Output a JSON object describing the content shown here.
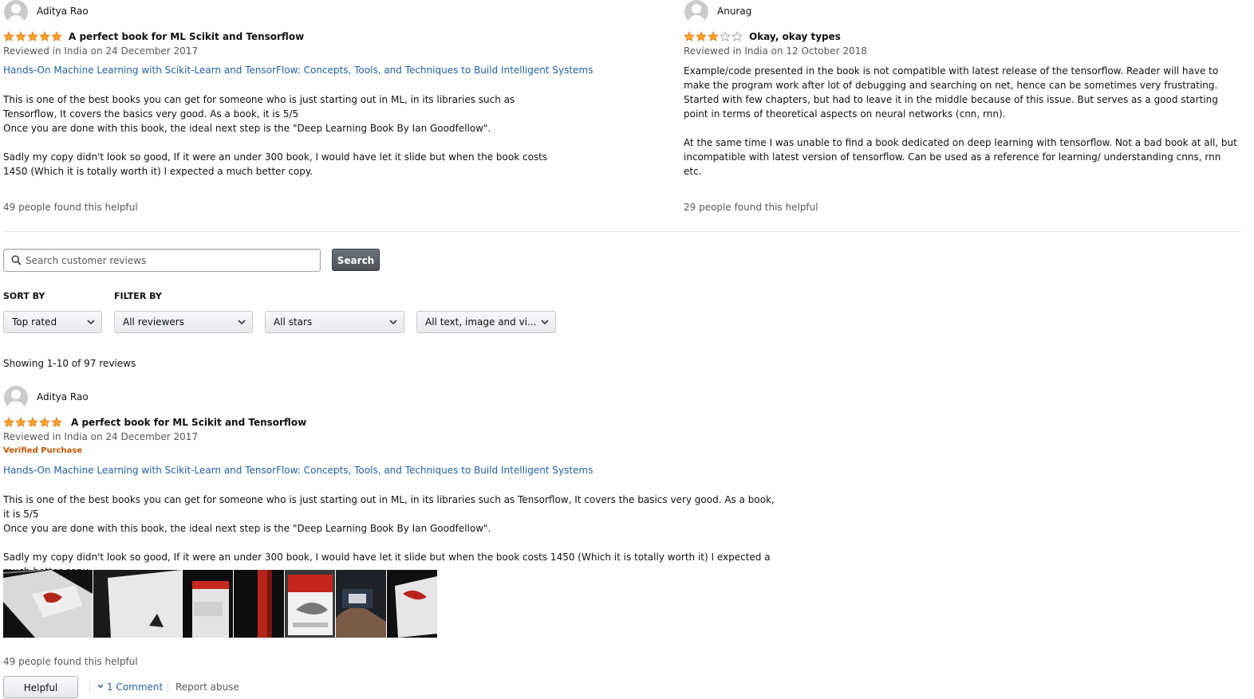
{
  "top_reviews": [
    {
      "reviewer": "Aditya Rao",
      "rating": 5,
      "title": "A perfect book for ML Scikit and Tensorflow",
      "date": "Reviewed in India on 24 December 2017",
      "product_link": "Hands-On Machine Learning with Scikit-Learn and TensorFlow: Concepts, Tools, and Techniques to Build Intelligent Systems",
      "body": [
        "This is one of the best books you can get for someone who is just starting out in ML, in its libraries such as Tensorflow, It covers the basics very good. As a book, it is 5/5",
        "Once you are done with this book, the ideal next step is the \"Deep Learning Book By Ian Goodfellow\".",
        "Sadly my copy didn't look so good, If it were an under 300 book, I would have let it slide but when the book costs 1450 (Which it is totally worth it) I expected a much better copy."
      ],
      "helpful": "49 people found this helpful"
    },
    {
      "reviewer": "Anurag",
      "rating": 3,
      "title": "Okay, okay types",
      "date": "Reviewed in India on 12 October 2018",
      "body": [
        "Example/code presented in the book is not compatible with latest release of the tensorflow. Reader will have to make the program work after lot of debugging and searching on net, hence can be sometimes very frustrating. Started with few chapters, but had to leave it in the middle because of this issue. But serves as a good starting point in terms of theoretical aspects on neural networks (cnn, rnn).",
        "At the same time I was unable to find a book dedicated on deep learning with tensorflow. Not a bad book at all, but incompatible with latest version of tensorflow. Can be used as a reference for learning/ understanding cnns, rnn etc."
      ],
      "helpful": "29 people found this helpful"
    }
  ],
  "search": {
    "placeholder": "Search customer reviews",
    "button": "Search"
  },
  "sort": {
    "label": "SORT BY",
    "selected": "Top rated"
  },
  "filter": {
    "label": "FILTER BY",
    "reviewers": "All reviewers",
    "stars": "All stars",
    "media": "All text, image and vi..."
  },
  "showing": "Showing 1-10 of 97 reviews",
  "review": {
    "reviewer": "Aditya Rao",
    "rating": 5,
    "title": "A perfect book for ML Scikit and Tensorflow",
    "date": "Reviewed in India on 24 December 2017",
    "verified": "Verified Purchase",
    "product_link": "Hands-On Machine Learning with Scikit-Learn and TensorFlow: Concepts, Tools, and Techniques to Build Intelligent Systems",
    "body": [
      "This is one of the best books you can get for someone who is just starting out in ML, in its libraries such as Tensorflow, It covers the basics very good. As a book, it is 5/5",
      "Once you are done with this book, the ideal next step is the \"Deep Learning Book By Ian Goodfellow\".",
      "Sadly my copy didn't look so good, If it were an under 300 book, I would have let it slide but when the book costs 1450 (Which it is totally worth it) I expected a much better copy."
    ],
    "images": [
      "review-photo-1",
      "review-photo-2",
      "review-photo-3",
      "review-photo-4",
      "review-photo-5",
      "review-photo-6",
      "review-photo-7"
    ],
    "helpful": "49 people found this helpful",
    "helpful_button": "Helpful",
    "comment_link": "1 Comment",
    "report": "Report abuse"
  },
  "colors": {
    "star": "#ffa41c",
    "link": "#2162a1",
    "verified": "#c45500",
    "muted": "#565959"
  }
}
